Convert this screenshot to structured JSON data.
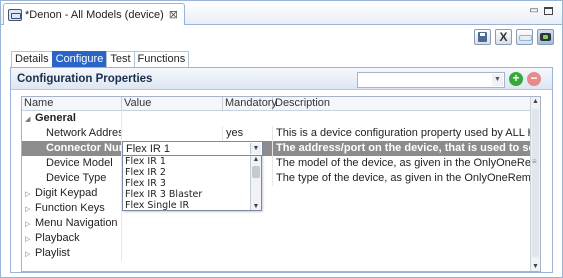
{
  "editor_tab": {
    "title": "*Denon - All Models (device)",
    "close": "⊠"
  },
  "window_buttons": {
    "minimize": "▭",
    "maximize": ""
  },
  "toolbar": {
    "save": "",
    "delete": "X",
    "link": "",
    "active": ""
  },
  "page_tabs": [
    "Details",
    "Configure",
    "Test",
    "Functions"
  ],
  "selected_tab": "Configure",
  "section": {
    "title": "Configuration Properties",
    "filter_value": "",
    "add_label": "+",
    "remove_label": "−"
  },
  "table": {
    "headers": [
      "Name",
      "Value",
      "Mandatory",
      "Description"
    ],
    "general_group": "General",
    "rows": [
      {
        "name": "Network Address",
        "value": "",
        "mandatory": "yes",
        "description": "This is a device configuration property used by ALL HDM"
      },
      {
        "name": "Connector Numb",
        "value": "Flex IR 1",
        "mandatory": "",
        "description": "The address/port on the device, that is used to send the"
      },
      {
        "name": "Device Model",
        "value": "",
        "mandatory": "",
        "description": "The model of the device, as given in the OnlyOneRemote"
      },
      {
        "name": "Device Type",
        "value": "",
        "mandatory": "",
        "description": "The type of the device, as given in the OnlyOneRemote d"
      }
    ],
    "groups": [
      "Digit Keypad",
      "Function Keys",
      "Menu Navigation",
      "Playback",
      "Playlist"
    ]
  },
  "dropdown": {
    "options": [
      "Flex IR 1",
      "Flex IR 2",
      "Flex IR 3",
      "Flex IR 3 Blaster",
      "Flex Single IR"
    ]
  },
  "colors": {
    "accent": "#2a64c6",
    "selected_row": "#8c8c8c",
    "add": "#37a83a",
    "remove": "#e88a8a"
  }
}
